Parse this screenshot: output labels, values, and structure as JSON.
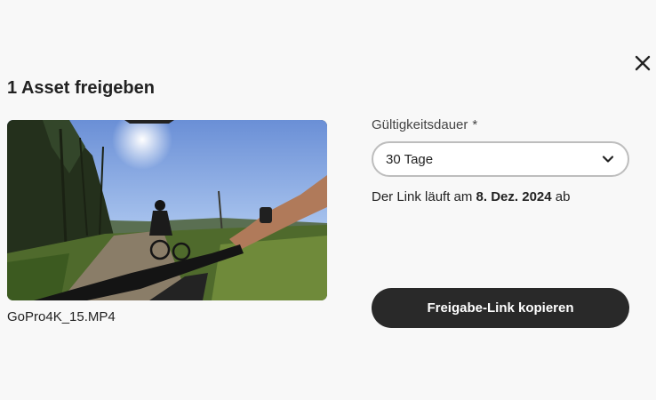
{
  "dialog": {
    "title": "1 Asset freigeben",
    "close_icon": "close-icon"
  },
  "asset": {
    "filename": "GoPro4K_15.MP4"
  },
  "validity": {
    "label": "Gültigkeitsdauer",
    "required_marker": "*",
    "selected": "30 Tage",
    "dropdown_icon": "chevron-down-icon"
  },
  "expiry": {
    "prefix": "Der Link läuft am ",
    "date": "8. Dez. 2024",
    "suffix": " ab"
  },
  "actions": {
    "copy_label": "Freigabe-Link kopieren"
  },
  "colors": {
    "background": "#f8f8f8",
    "primary_button": "#292929",
    "text": "#222222"
  }
}
